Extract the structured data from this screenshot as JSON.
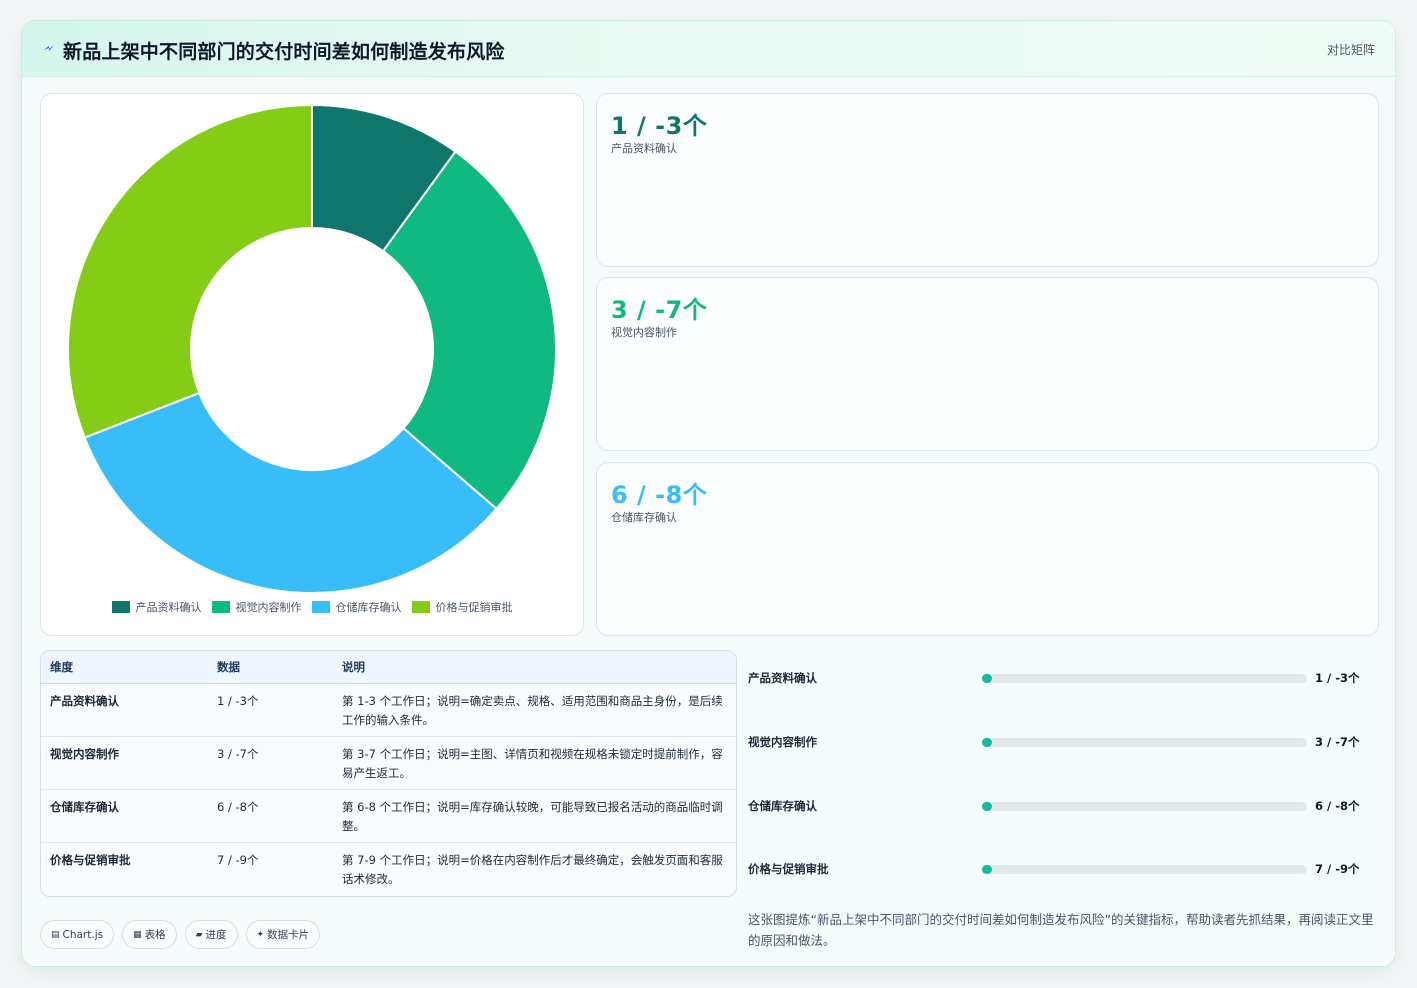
{
  "header": {
    "title": "新品上架中不同部门的交付时间差如何制造发布风险",
    "tag": "对比矩阵"
  },
  "colors": {
    "accent": "#14b8a6",
    "series": [
      "#0f766e",
      "#10b981",
      "#38bdf8",
      "#84cc16"
    ]
  },
  "chart_data": {
    "type": "pie",
    "variant": "doughnut",
    "categories": [
      "产品资料确认",
      "视觉内容制作",
      "仓储库存确认",
      "价格与促销审批"
    ],
    "values": [
      1.1,
      2.9,
      3.6,
      3.4
    ],
    "colors": [
      "#0f766e",
      "#10b981",
      "#38bdf8",
      "#84cc16"
    ],
    "legend_position": "bottom"
  },
  "stats": [
    {
      "value": "1 / -3个",
      "label": "产品资料确认",
      "color": "#0f766e"
    },
    {
      "value": "3 / -7个",
      "label": "视觉内容制作",
      "color": "#10b981"
    },
    {
      "value": "6 / -8个",
      "label": "仓储库存确认",
      "color": "#38bdf8"
    }
  ],
  "table": {
    "headers": [
      "维度",
      "数据",
      "说明"
    ],
    "rows": [
      [
        "产品资料确认",
        "1 / -3个",
        "第 1-3 个工作日；说明=确定卖点、规格、适用范围和商品主身份，是后续工作的输入条件。"
      ],
      [
        "视觉内容制作",
        "3 / -7个",
        "第 3-7 个工作日；说明=主图、详情页和视频在规格未锁定时提前制作，容易产生返工。"
      ],
      [
        "仓储库存确认",
        "6 / -8个",
        "第 6-8 个工作日；说明=库存确认较晚，可能导致已报名活动的商品临时调整。"
      ],
      [
        "价格与促销审批",
        "7 / -9个",
        "第 7-9 个工作日；说明=价格在内容制作后才最终确定，会触发页面和客服话术修改。"
      ]
    ]
  },
  "progress": [
    {
      "name": "产品资料确认",
      "value_text": "1 / -3个",
      "fraction": 0.03
    },
    {
      "name": "视觉内容制作",
      "value_text": "3 / -7个",
      "fraction": 0.03
    },
    {
      "name": "仓储库存确认",
      "value_text": "6 / -8个",
      "fraction": 0.03
    },
    {
      "name": "价格与促销审批",
      "value_text": "7 / -9个",
      "fraction": 0.03
    }
  ],
  "chips": [
    {
      "icon": "chart-icon",
      "glyph": "▤",
      "label": "Chart.js"
    },
    {
      "icon": "table-icon",
      "glyph": "▦",
      "label": "表格"
    },
    {
      "icon": "progress-icon",
      "glyph": "▰",
      "label": "进度"
    },
    {
      "icon": "sparkle-icon",
      "glyph": "✦",
      "label": "数据卡片"
    }
  ],
  "note": "这张图提炼“新品上架中不同部门的交付时间差如何制造发布风险”的关键指标，帮助读者先抓结果，再阅读正文里的原因和做法。"
}
